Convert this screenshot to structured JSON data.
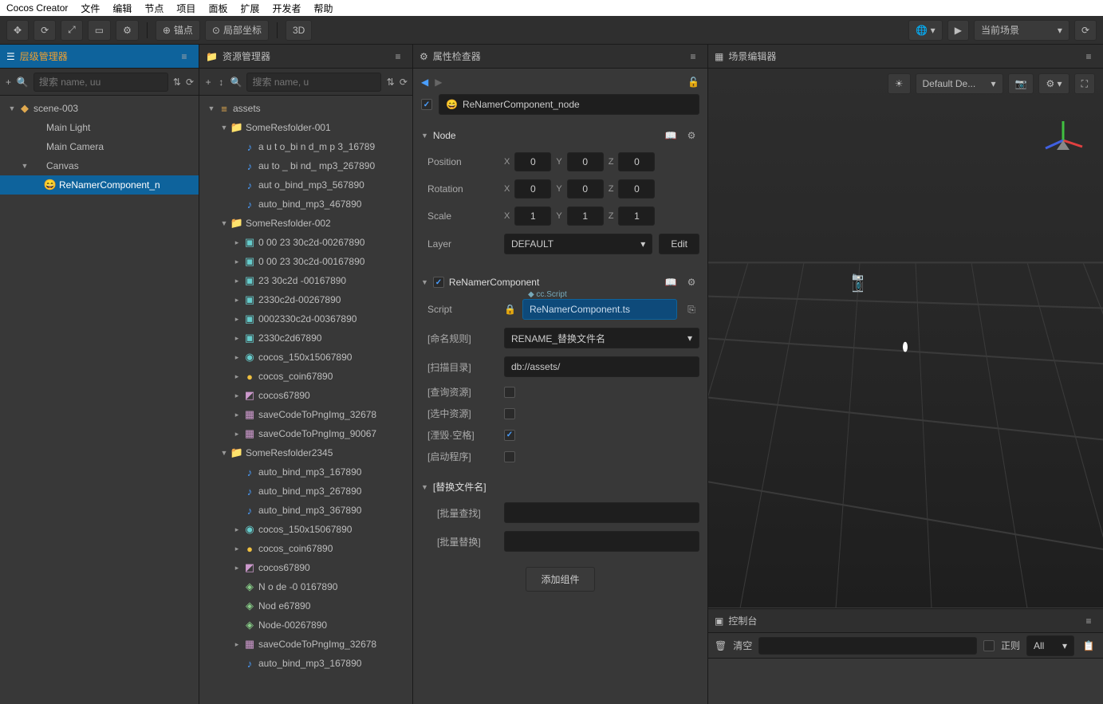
{
  "app_title": "Cocos Creator",
  "menu": [
    "文件",
    "编辑",
    "节点",
    "项目",
    "面板",
    "扩展",
    "开发者",
    "帮助"
  ],
  "toolbar": {
    "anchor": "锚点",
    "local": "局部坐标",
    "mode3d": "3D",
    "scene_dropdown": "当前场景"
  },
  "hierarchy": {
    "title": "层级管理器",
    "search_placeholder": "搜索 name, uu",
    "tree": [
      {
        "indent": 0,
        "arrow": "▼",
        "icon": "◆",
        "iconcls": "ic-db",
        "label": "scene-003"
      },
      {
        "indent": 1,
        "arrow": "",
        "icon": "",
        "iconcls": "",
        "label": "Main Light"
      },
      {
        "indent": 1,
        "arrow": "",
        "icon": "",
        "iconcls": "",
        "label": "Main Camera"
      },
      {
        "indent": 1,
        "arrow": "▼",
        "icon": "",
        "iconcls": "",
        "label": "Canvas"
      },
      {
        "indent": 2,
        "arrow": "",
        "icon": "😄",
        "iconcls": "ic-emoji",
        "label": "ReNamerComponent_n",
        "selected": true
      }
    ]
  },
  "assets": {
    "title": "资源管理器",
    "search_placeholder": "搜索 name, u",
    "tree": [
      {
        "indent": 0,
        "arrow": "▼",
        "icon": "≡",
        "iconcls": "ic-db",
        "label": "assets"
      },
      {
        "indent": 1,
        "arrow": "▼",
        "icon": "📁",
        "iconcls": "ic-folder",
        "label": "SomeResfolder-001"
      },
      {
        "indent": 2,
        "arrow": "",
        "icon": "♪",
        "iconcls": "ic-audio",
        "label": "a u t o_bi n d_m p 3_16789"
      },
      {
        "indent": 2,
        "arrow": "",
        "icon": "♪",
        "iconcls": "ic-audio",
        "label": "au to _ bi nd_ mp3_267890"
      },
      {
        "indent": 2,
        "arrow": "",
        "icon": "♪",
        "iconcls": "ic-audio",
        "label": "aut o_bind_mp3_567890"
      },
      {
        "indent": 2,
        "arrow": "",
        "icon": "♪",
        "iconcls": "ic-audio",
        "label": "auto_bind_mp3_467890"
      },
      {
        "indent": 1,
        "arrow": "▼",
        "icon": "📁",
        "iconcls": "ic-folder",
        "label": "SomeResfolder-002"
      },
      {
        "indent": 2,
        "arrow": "▸",
        "icon": "▣",
        "iconcls": "ic-pref",
        "label": "0 00 23 30c2d-00267890"
      },
      {
        "indent": 2,
        "arrow": "▸",
        "icon": "▣",
        "iconcls": "ic-pref",
        "label": "0 00 23 30c2d-00167890"
      },
      {
        "indent": 2,
        "arrow": "▸",
        "icon": "▣",
        "iconcls": "ic-pref",
        "label": "23 30c2d -00167890"
      },
      {
        "indent": 2,
        "arrow": "▸",
        "icon": "▣",
        "iconcls": "ic-pref",
        "label": "2330c2d-00267890"
      },
      {
        "indent": 2,
        "arrow": "▸",
        "icon": "▣",
        "iconcls": "ic-pref",
        "label": "0002330c2d-00367890"
      },
      {
        "indent": 2,
        "arrow": "▸",
        "icon": "▣",
        "iconcls": "ic-pref",
        "label": "2330c2d67890"
      },
      {
        "indent": 2,
        "arrow": "▸",
        "icon": "◉",
        "iconcls": "ic-pref",
        "label": "cocos_150x15067890"
      },
      {
        "indent": 2,
        "arrow": "▸",
        "icon": "●",
        "iconcls": "ic-coin",
        "label": "cocos_coin67890"
      },
      {
        "indent": 2,
        "arrow": "▸",
        "icon": "◩",
        "iconcls": "ic-img",
        "label": "cocos67890"
      },
      {
        "indent": 2,
        "arrow": "▸",
        "icon": "▦",
        "iconcls": "ic-img",
        "label": "saveCodeToPngImg_32678"
      },
      {
        "indent": 2,
        "arrow": "▸",
        "icon": "▦",
        "iconcls": "ic-img",
        "label": "saveCodeToPngImg_90067"
      },
      {
        "indent": 1,
        "arrow": "▼",
        "icon": "📁",
        "iconcls": "ic-folder",
        "label": "SomeResfolder2345"
      },
      {
        "indent": 2,
        "arrow": "",
        "icon": "♪",
        "iconcls": "ic-audio",
        "label": "auto_bind_mp3_167890"
      },
      {
        "indent": 2,
        "arrow": "",
        "icon": "♪",
        "iconcls": "ic-audio",
        "label": "auto_bind_mp3_267890"
      },
      {
        "indent": 2,
        "arrow": "",
        "icon": "♪",
        "iconcls": "ic-audio",
        "label": "auto_bind_mp3_367890"
      },
      {
        "indent": 2,
        "arrow": "▸",
        "icon": "◉",
        "iconcls": "ic-pref",
        "label": "cocos_150x15067890"
      },
      {
        "indent": 2,
        "arrow": "▸",
        "icon": "●",
        "iconcls": "ic-coin",
        "label": "cocos_coin67890"
      },
      {
        "indent": 2,
        "arrow": "▸",
        "icon": "◩",
        "iconcls": "ic-img",
        "label": "cocos67890"
      },
      {
        "indent": 2,
        "arrow": "",
        "icon": "◈",
        "iconcls": "ic-node",
        "label": "N o de -0 0167890"
      },
      {
        "indent": 2,
        "arrow": "",
        "icon": "◈",
        "iconcls": "ic-node",
        "label": "Nod e67890"
      },
      {
        "indent": 2,
        "arrow": "",
        "icon": "◈",
        "iconcls": "ic-node",
        "label": "Node-00267890"
      },
      {
        "indent": 2,
        "arrow": "▸",
        "icon": "▦",
        "iconcls": "ic-img",
        "label": "saveCodeToPngImg_32678"
      },
      {
        "indent": 2,
        "arrow": "",
        "icon": "♪",
        "iconcls": "ic-audio",
        "label": "auto_bind_mp3_167890"
      }
    ]
  },
  "inspector": {
    "title": "属性检查器",
    "node_name": "ReNamerComponent_node",
    "node_section": "Node",
    "position": "Position",
    "rotation": "Rotation",
    "scale": "Scale",
    "layer": "Layer",
    "layer_value": "DEFAULT",
    "edit": "Edit",
    "pos": {
      "x": "0",
      "y": "0",
      "z": "0"
    },
    "rot": {
      "x": "0",
      "y": "0",
      "z": "0"
    },
    "scl": {
      "x": "1",
      "y": "1",
      "z": "1"
    },
    "component_name": "ReNamerComponent",
    "script_label": "Script",
    "script_tag": "◆ cc.Script",
    "script_value": "ReNamerComponent.ts",
    "rule_label": "[命名规则]",
    "rule_value": "RENAME_替换文件名",
    "scan_label": "[扫描目录]",
    "scan_value": "db://assets/",
    "query_label": "[查询资源]",
    "sel_label": "[选中资源]",
    "trim_label": "[湮毁·空格]",
    "start_label": "[启动程序]",
    "replace_section": "[替换文件名]",
    "batch_find": "[批量查找]",
    "batch_replace": "[批量替换]",
    "add_component": "添加组件"
  },
  "scene": {
    "title": "场景编辑器",
    "default_label": "Default De..."
  },
  "console": {
    "title": "控制台",
    "clear": "清空",
    "regex": "正则",
    "all": "All"
  }
}
